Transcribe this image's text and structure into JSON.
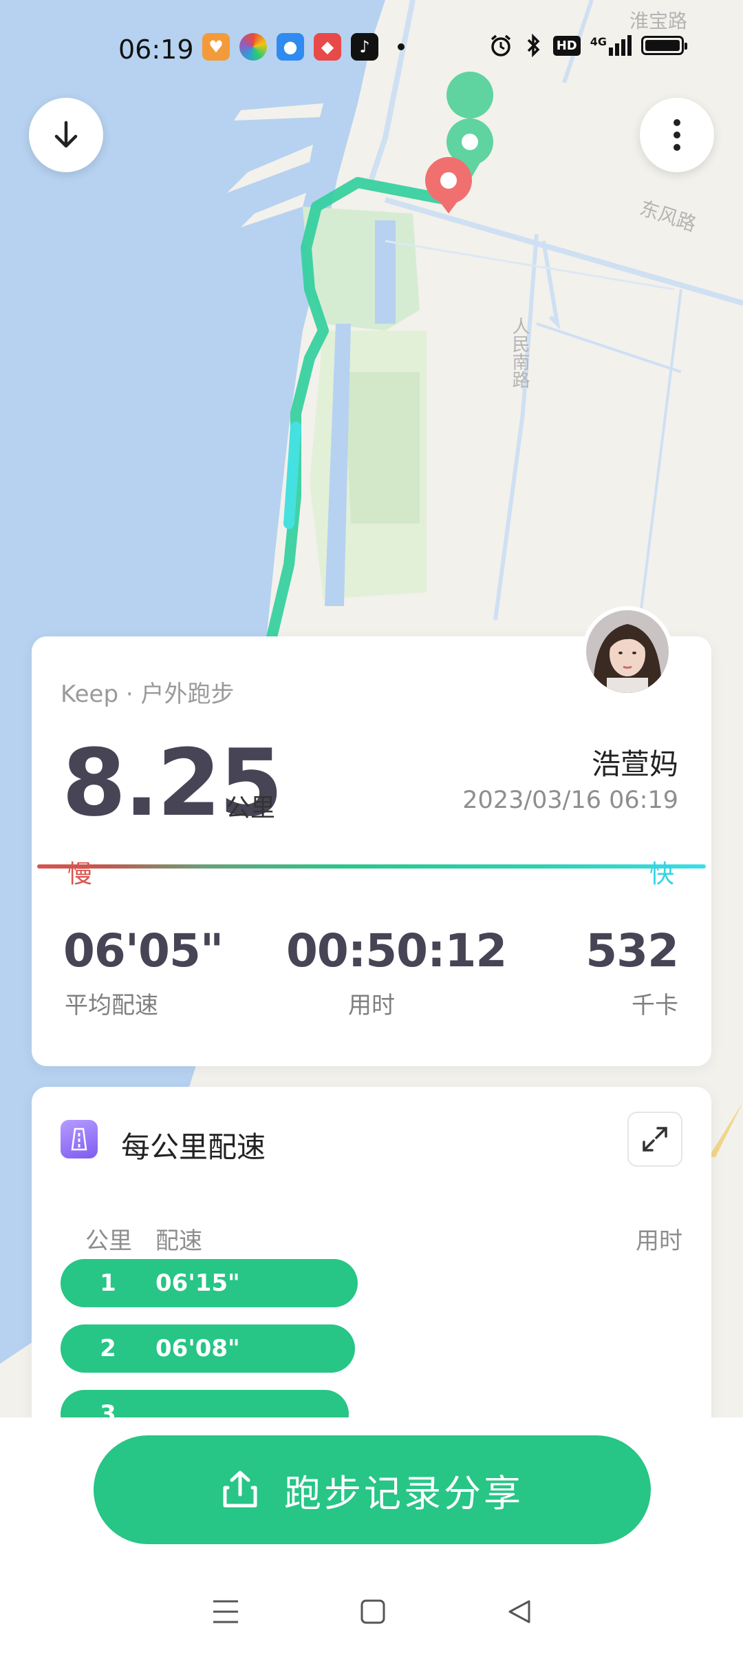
{
  "status_bar": {
    "time": "06:19",
    "app_icons": [
      "huawei-health-icon",
      "multicolor-app-icon",
      "browser-icon",
      "red-app-icon",
      "tiktok-icon"
    ],
    "indicators": [
      "alarm-icon",
      "bluetooth-icon",
      "hd-icon",
      "signal-4g-icon",
      "battery-icon"
    ],
    "network": "4G",
    "hd": "HD"
  },
  "map": {
    "streets": [
      "淮宝路",
      "东风路",
      "人民南路"
    ],
    "start_marker_color": "#5fd3a0",
    "end_marker_color": "#f07070",
    "route_color": "#35c98f"
  },
  "summary": {
    "source": "Keep · 户外跑步",
    "distance": "8.25",
    "distance_unit": "公里",
    "username": "浩萱妈",
    "datetime": "2023/03/16 06:19",
    "slow_label": "慢",
    "fast_label": "快",
    "stats": [
      {
        "value": "06'05\"",
        "label": "平均配速"
      },
      {
        "value": "00:50:12",
        "label": "用时"
      },
      {
        "value": "532",
        "label": "千卡"
      }
    ]
  },
  "splits": {
    "title": "每公里配速",
    "col_km": "公里",
    "col_pace": "配速",
    "col_time": "用时",
    "rows": [
      {
        "km": "1",
        "pace": "06'15\"",
        "fraction": 0.96
      },
      {
        "km": "2",
        "pace": "06'08\"",
        "fraction": 0.95
      },
      {
        "km": "3",
        "pace": "",
        "fraction": 0.93
      }
    ]
  },
  "share_button": {
    "label": "跑步记录分享"
  },
  "colors": {
    "accent": "#27c586",
    "stat_text": "#474455",
    "slow": "#d9534f",
    "fast": "#34d4e4"
  }
}
